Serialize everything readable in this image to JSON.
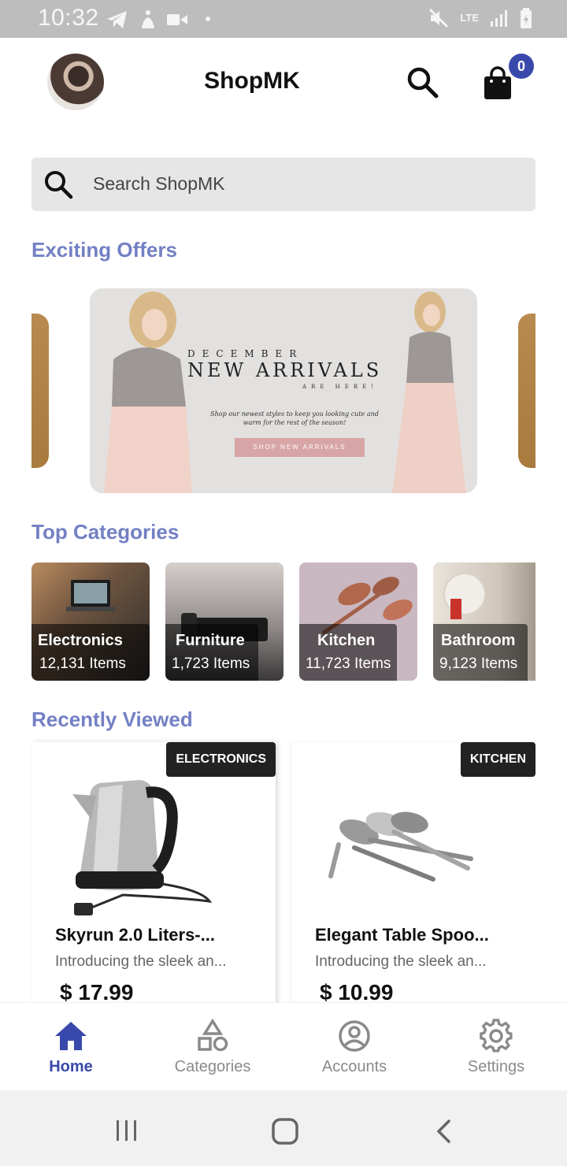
{
  "status_bar": {
    "time": "10:32",
    "network": "LTE"
  },
  "header": {
    "title": "ShopMK",
    "cart_count": "0"
  },
  "search": {
    "placeholder": "Search ShopMK"
  },
  "offers": {
    "title": "Exciting Offers",
    "banner": {
      "month": "DECEMBER",
      "headline": "NEW ARRIVALS",
      "subhead": "ARE HERE!",
      "copy": "Shop our newest styles to keep you looking cute and warm for the rest of the season!",
      "cta": "SHOP NEW ARRIVALS"
    }
  },
  "categories": {
    "title": "Top Categories",
    "items": [
      {
        "name": "Electronics",
        "count": "12,131 Items"
      },
      {
        "name": "Furniture",
        "count": "1,723 Items"
      },
      {
        "name": "Kitchen",
        "count": "11,723 Items"
      },
      {
        "name": "Bathroom",
        "count": "9,123 Items"
      }
    ]
  },
  "recent": {
    "title": "Recently Viewed",
    "items": [
      {
        "tag": "ELECTRONICS",
        "name": "Skyrun 2.0 Liters-...",
        "desc": "Introducing the sleek an...",
        "price": "$ 17.99"
      },
      {
        "tag": "KITCHEN",
        "name": "Elegant Table Spoo...",
        "desc": "Introducing the sleek an...",
        "price": "$ 10.99"
      }
    ]
  },
  "nav": {
    "items": [
      {
        "label": "Home",
        "icon": "home-icon"
      },
      {
        "label": "Categories",
        "icon": "categories-icon"
      },
      {
        "label": "Accounts",
        "icon": "account-icon"
      },
      {
        "label": "Settings",
        "icon": "settings-icon"
      }
    ],
    "active_color": "#3949ab"
  },
  "colors": {
    "accent": "#3949ab",
    "section_title": "#7380c4"
  }
}
